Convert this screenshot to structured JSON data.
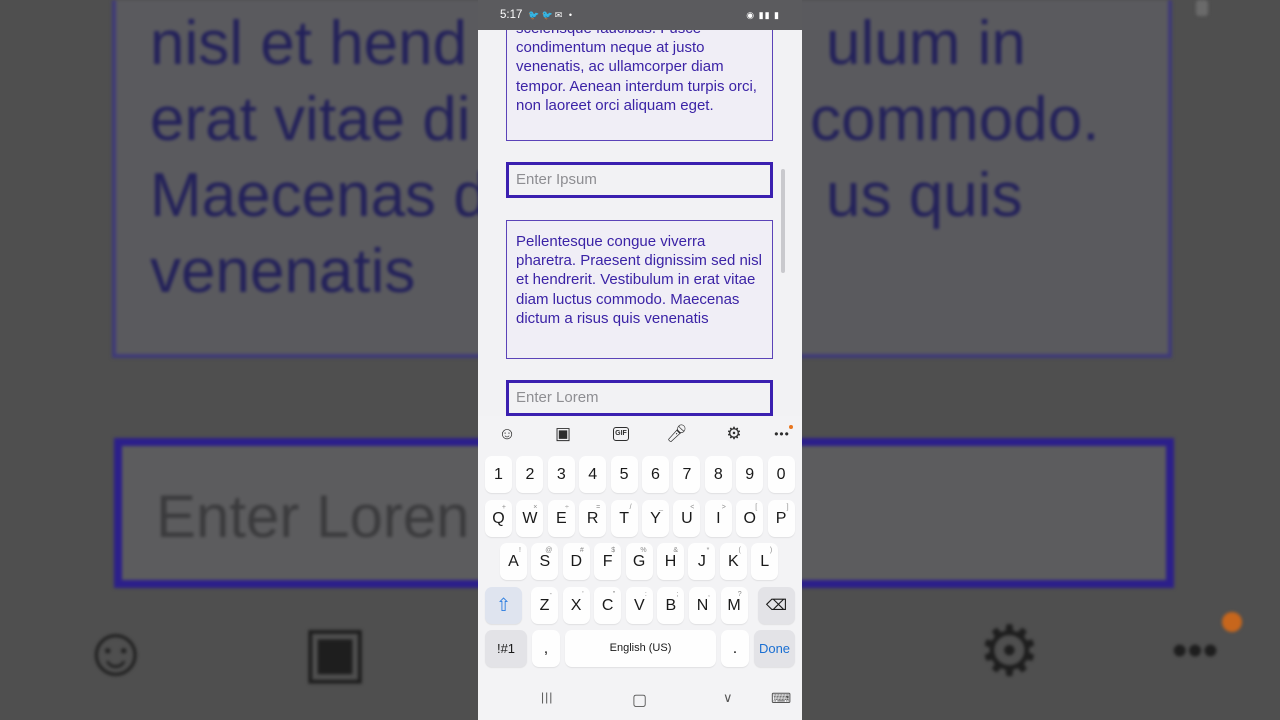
{
  "background": {
    "text_lines": [
      "nisl et hend",
      "erat vitae di",
      "Maecenas d",
      "venenatis"
    ],
    "text_lines_right": [
      "ulum in",
      "commodo.",
      "us quis"
    ],
    "input_placeholder": "Enter Loren"
  },
  "status_bar": {
    "time": "5:17",
    "notification_icons": "🐦🐦✉ •",
    "system_icons": "◉ ▮▮ ▮"
  },
  "content": {
    "paragraph_1": "scelerisque faucibus. Fusce condimentum neque at justo venenatis, ac ullamcorper diam tempor. Aenean interdum turpis orci, non laoreet orci aliquam eget.",
    "input_ipsum_placeholder": "Enter Ipsum",
    "paragraph_2": "Pellentesque congue viverra pharetra. Praesent dignissim sed nisl et hendrerit. Vestibulum in erat vitae diam luctus commodo. Maecenas dictum a risus quis venenatis",
    "input_lorem_placeholder": "Enter Lorem"
  },
  "keyboard": {
    "toolbar_icons": [
      "emoji-icon",
      "sticker-icon",
      "gif-icon",
      "mic-icon",
      "settings-icon",
      "more-icon"
    ],
    "gif_label": "GIF",
    "numbers": [
      "1",
      "2",
      "3",
      "4",
      "5",
      "6",
      "7",
      "8",
      "9",
      "0"
    ],
    "row_q": [
      {
        "k": "Q",
        "s": "+"
      },
      {
        "k": "W",
        "s": "×"
      },
      {
        "k": "E",
        "s": "÷"
      },
      {
        "k": "R",
        "s": "="
      },
      {
        "k": "T",
        "s": "/"
      },
      {
        "k": "Y",
        "s": "_"
      },
      {
        "k": "U",
        "s": "<"
      },
      {
        "k": "I",
        "s": ">"
      },
      {
        "k": "O",
        "s": "["
      },
      {
        "k": "P",
        "s": "]"
      }
    ],
    "row_a": [
      {
        "k": "A",
        "s": "!"
      },
      {
        "k": "S",
        "s": "@"
      },
      {
        "k": "D",
        "s": "#"
      },
      {
        "k": "F",
        "s": "$"
      },
      {
        "k": "G",
        "s": "%"
      },
      {
        "k": "H",
        "s": "&"
      },
      {
        "k": "J",
        "s": "*"
      },
      {
        "k": "K",
        "s": "("
      },
      {
        "k": "L",
        "s": ")"
      }
    ],
    "row_z": [
      {
        "k": "Z",
        "s": "-"
      },
      {
        "k": "X",
        "s": "'"
      },
      {
        "k": "C",
        "s": "\""
      },
      {
        "k": "V",
        "s": ":"
      },
      {
        "k": "B",
        "s": ";"
      },
      {
        "k": "N",
        "s": ","
      },
      {
        "k": "M",
        "s": "?"
      }
    ],
    "shift_glyph": "⇧",
    "backspace_glyph": "⌫",
    "symbols_label": "!#1",
    "comma_label": ",",
    "space_label": "English (US)",
    "period_label": ".",
    "done_label": "Done"
  },
  "nav_bar": {
    "recents_glyph": "|||",
    "home_glyph": "▢",
    "back_glyph": "∨",
    "keyboard_glyph": "⌨"
  }
}
